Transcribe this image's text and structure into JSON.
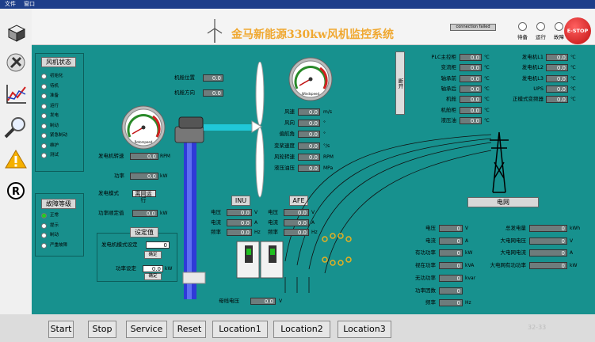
{
  "menu": [
    "文件",
    "窗口"
  ],
  "title": "金马新能源330kw风机监控系统",
  "conn_status": "connection failed",
  "lamps": [
    "待备",
    "运行",
    "故障"
  ],
  "estop": "E-STOP",
  "left_panel": {
    "title": "风机状态",
    "items": [
      "初始化",
      "待机",
      "准备",
      "运行",
      "发电",
      "制动",
      "紧急制动",
      "维护",
      "测试"
    ]
  },
  "fault_panel": {
    "title": "故障等级",
    "items": [
      "正常",
      "提示",
      "制动",
      "严重故障"
    ]
  },
  "nacelle": {
    "pos_label": "机舱位置",
    "pos_val": "0.0",
    "dir_label": "机舱方向",
    "dir_val": "0.0"
  },
  "gauge1_label": "Rotorspeed",
  "gauge2_label": "Windspeed",
  "gen": {
    "speed_label": "发电机转速",
    "speed_val": "0.0",
    "speed_unit": "RPM",
    "power_label": "功率",
    "power_val": "0.0",
    "power_unit": "kW",
    "mode_label": "发电模式",
    "mode_val": "离网运行",
    "power_set_label": "功率顺定值",
    "power_set_val": "0.0",
    "power_set_unit": "kW"
  },
  "setpanel": {
    "title": "设定值",
    "mode_label": "发电机模式设定",
    "mode_val": "0",
    "confirm": "确定",
    "power_label": "功率设定",
    "power_val": "0.0",
    "power_unit": "kW",
    "confirm2": "确定"
  },
  "wind": [
    {
      "label": "风速",
      "val": "0.0",
      "unit": "m/s"
    },
    {
      "label": "风向",
      "val": "0.0",
      "unit": "°"
    },
    {
      "label": "偏航角",
      "val": "0.0",
      "unit": "°"
    },
    {
      "label": "变桨速度",
      "val": "0.0",
      "unit": "°/s"
    },
    {
      "label": "风轮转速",
      "val": "0.0",
      "unit": "RPM"
    },
    {
      "label": "液压油压",
      "val": "0.0",
      "unit": "MPa"
    }
  ],
  "inu": {
    "title": "INU",
    "rows": [
      {
        "label": "电压",
        "val": "0.0",
        "unit": "V"
      },
      {
        "label": "电流",
        "val": "0.0",
        "unit": "A"
      },
      {
        "label": "频率",
        "val": "0.0",
        "unit": "Hz"
      }
    ]
  },
  "afe": {
    "title": "AFE",
    "rows": [
      {
        "label": "电压",
        "val": "0.0",
        "unit": "V"
      },
      {
        "label": "电流",
        "val": "0.0",
        "unit": "A"
      },
      {
        "label": "频率",
        "val": "0.0",
        "unit": "Hz"
      }
    ]
  },
  "busbar": {
    "label": "母线电压",
    "val": "0.0",
    "unit": "V"
  },
  "vert_button": "断开",
  "temps": [
    {
      "label": "PLC主控柜",
      "val": "0.0",
      "unit": "℃"
    },
    {
      "label": "变流柜",
      "val": "0.0",
      "unit": "℃"
    },
    {
      "label": "轴承前",
      "val": "0.0",
      "unit": "℃"
    },
    {
      "label": "轴承后",
      "val": "0.0",
      "unit": "℃"
    },
    {
      "label": "机舱",
      "val": "0.0",
      "unit": "℃"
    },
    {
      "label": "机舱柜",
      "val": "0.0",
      "unit": "℃"
    },
    {
      "label": "液压油",
      "val": "0.0",
      "unit": "℃"
    }
  ],
  "temps2": [
    {
      "label": "发电机L1",
      "val": "0.0",
      "unit": "℃"
    },
    {
      "label": "发电机L2",
      "val": "0.0",
      "unit": "℃"
    },
    {
      "label": "发电机L3",
      "val": "0.0",
      "unit": "℃"
    },
    {
      "label": "UPS",
      "val": "0.0",
      "unit": "℃"
    },
    {
      "label": "正模式变频器",
      "val": "0.0",
      "unit": "℃"
    }
  ],
  "grid_title": "电网",
  "grid_left": [
    {
      "label": "电压",
      "val": "0",
      "unit": "V"
    },
    {
      "label": "电流",
      "val": "0",
      "unit": "A"
    },
    {
      "label": "有功功率",
      "val": "0",
      "unit": "kW"
    },
    {
      "label": "视在功率",
      "val": "0",
      "unit": "kVA"
    },
    {
      "label": "无功功率",
      "val": "0",
      "unit": "kvar"
    },
    {
      "label": "功率因数",
      "val": "0",
      "unit": ""
    },
    {
      "label": "频率",
      "val": "0",
      "unit": "Hz"
    }
  ],
  "grid_right": [
    {
      "label": "总发电量",
      "val": "0",
      "unit": "kWh"
    },
    {
      "label": "大电网电压",
      "val": "0",
      "unit": "V"
    },
    {
      "label": "大电网电流",
      "val": "0",
      "unit": "A"
    },
    {
      "label": "大电网有功功率",
      "val": "0",
      "unit": "kW"
    }
  ],
  "bottom_buttons": [
    "Start",
    "Stop",
    "Service",
    "Reset",
    "Location1",
    "Location2",
    "Location3"
  ],
  "page_num": "32-33",
  "exit": "退出",
  "colors": {
    "accent": "#17918e",
    "title": "#f0a830",
    "estop": "#e02020"
  }
}
